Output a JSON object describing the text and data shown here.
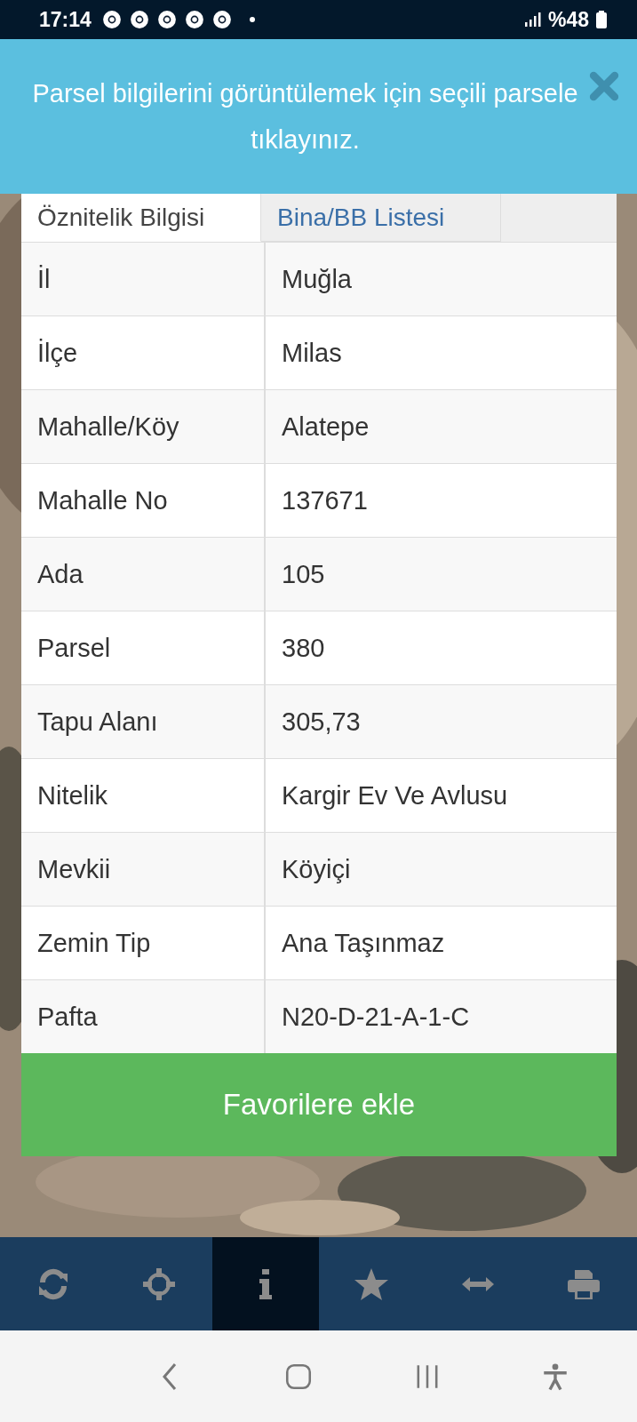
{
  "status_bar": {
    "time": "17:14",
    "battery": "%48"
  },
  "banner": {
    "message": "Parsel bilgilerini görüntülemek için seçili parsele tıklayınız."
  },
  "tabs": [
    {
      "label": "Öznitelik Bilgisi",
      "selected": true
    },
    {
      "label": "Bina/BB Listesi",
      "selected": false
    }
  ],
  "table": {
    "rows": [
      {
        "label": "İl",
        "value": "Muğla"
      },
      {
        "label": "İlçe",
        "value": "Milas"
      },
      {
        "label": "Mahalle/Köy",
        "value": "Alatepe"
      },
      {
        "label": "Mahalle No",
        "value": "137671"
      },
      {
        "label": "Ada",
        "value": "105"
      },
      {
        "label": "Parsel",
        "value": "380"
      },
      {
        "label": "Tapu Alanı",
        "value": "305,73"
      },
      {
        "label": "Nitelik",
        "value": "Kargir Ev Ve Avlusu"
      },
      {
        "label": "Mevkii",
        "value": "Köyiçi"
      },
      {
        "label": "Zemin Tip",
        "value": "Ana Taşınmaz"
      },
      {
        "label": "Pafta",
        "value": "N20-D-21-A-1-C"
      }
    ]
  },
  "add_favorites_button": "Favorilere ekle",
  "toolbar": [
    {
      "kind": "refresh",
      "selected": false
    },
    {
      "kind": "locate",
      "selected": false
    },
    {
      "kind": "info",
      "selected": true
    },
    {
      "kind": "star",
      "selected": false
    },
    {
      "kind": "measure",
      "selected": false
    },
    {
      "kind": "print",
      "selected": false
    }
  ]
}
